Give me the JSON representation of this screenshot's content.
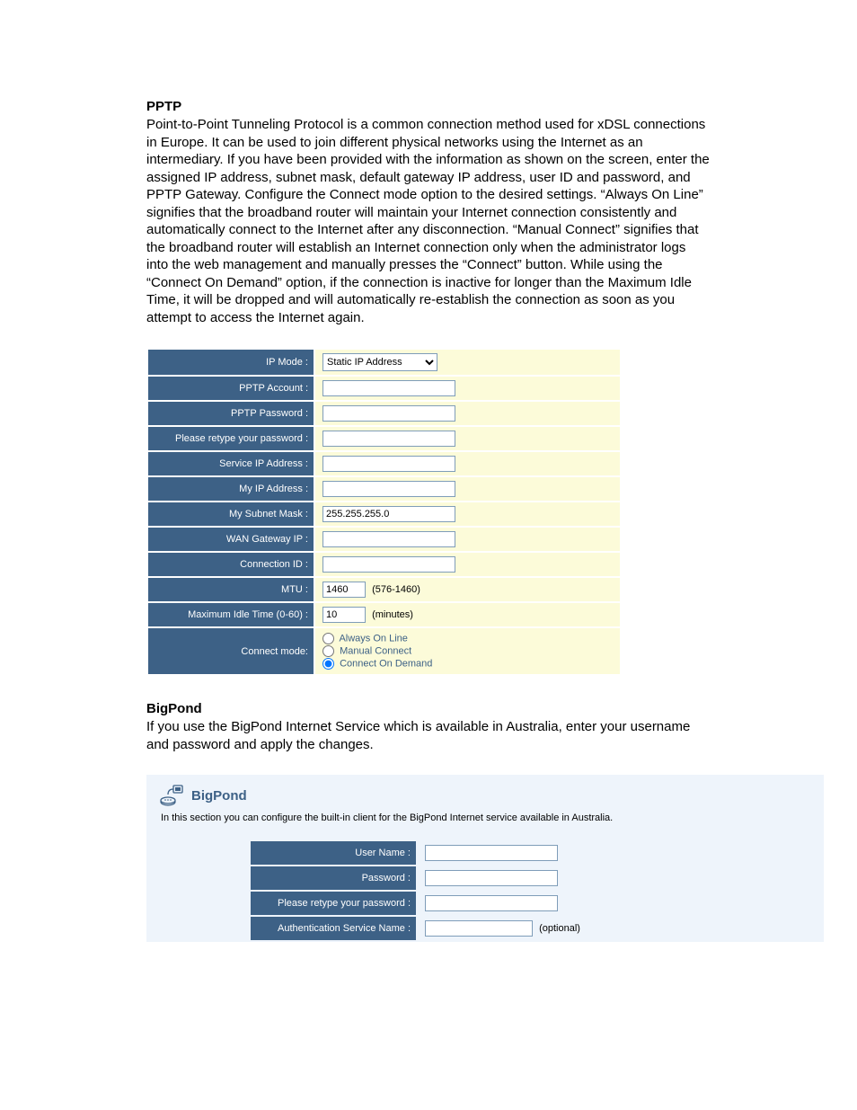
{
  "pptp": {
    "heading": "PPTP",
    "body": "Point-to-Point Tunneling Protocol is a common connection method used for xDSL connections in Europe. It can be used to join different physical networks using the Internet as an intermediary. If you have been provided with the information as shown on the screen, enter the assigned IP address, subnet mask, default gateway IP address, user ID and password, and PPTP Gateway. Configure the Connect mode option to the desired settings. “Always On Line” signifies that the broadband router will maintain your Internet connection consistently and automatically connect to the Internet after any disconnection. “Manual Connect” signifies that the broadband router will establish an Internet connection only when the administrator logs into the web management and manually presses the “Connect” button. While using the “Connect On Demand” option, if the connection is inactive for longer than the Maximum Idle Time, it will be dropped and will automatically re-establish the connection as soon as you attempt to access the Internet again.",
    "labels": {
      "ip_mode": "IP Mode :",
      "pptp_account": "PPTP Account :",
      "pptp_password": "PPTP Password :",
      "retype_password": "Please retype your password :",
      "service_ip": "Service IP Address :",
      "my_ip": "My IP Address :",
      "my_subnet": "My Subnet Mask :",
      "wan_gateway": "WAN Gateway IP :",
      "connection_id": "Connection ID :",
      "mtu": "MTU :",
      "max_idle": "Maximum Idle Time (0-60) :",
      "connect_mode": "Connect mode:"
    },
    "values": {
      "ip_mode": "Static IP Address",
      "pptp_account": "",
      "pptp_password": "",
      "retype_password": "",
      "service_ip": "",
      "my_ip": "",
      "my_subnet": "255.255.255.0",
      "wan_gateway": "",
      "connection_id": "",
      "mtu": "1460",
      "max_idle": "10"
    },
    "hints": {
      "mtu": "(576-1460)",
      "max_idle": "(minutes)"
    },
    "connect_options": {
      "always": "Always On Line",
      "manual": "Manual Connect",
      "demand": "Connect On Demand"
    }
  },
  "bigpond": {
    "heading": "BigPond",
    "body": "If you use the BigPond Internet Service which is available in Australia, enter your username and password and apply the changes.",
    "panel_title": "BigPond",
    "panel_desc": "In this section you can configure the built-in client for the BigPond Internet service available in Australia.",
    "labels": {
      "username": "User Name :",
      "password": "Password :",
      "retype_password": "Please retype your password :",
      "auth_service": "Authentication Service Name :"
    },
    "values": {
      "username": "",
      "password": "",
      "retype_password": "",
      "auth_service": ""
    },
    "hints": {
      "auth_service": "(optional)"
    }
  }
}
